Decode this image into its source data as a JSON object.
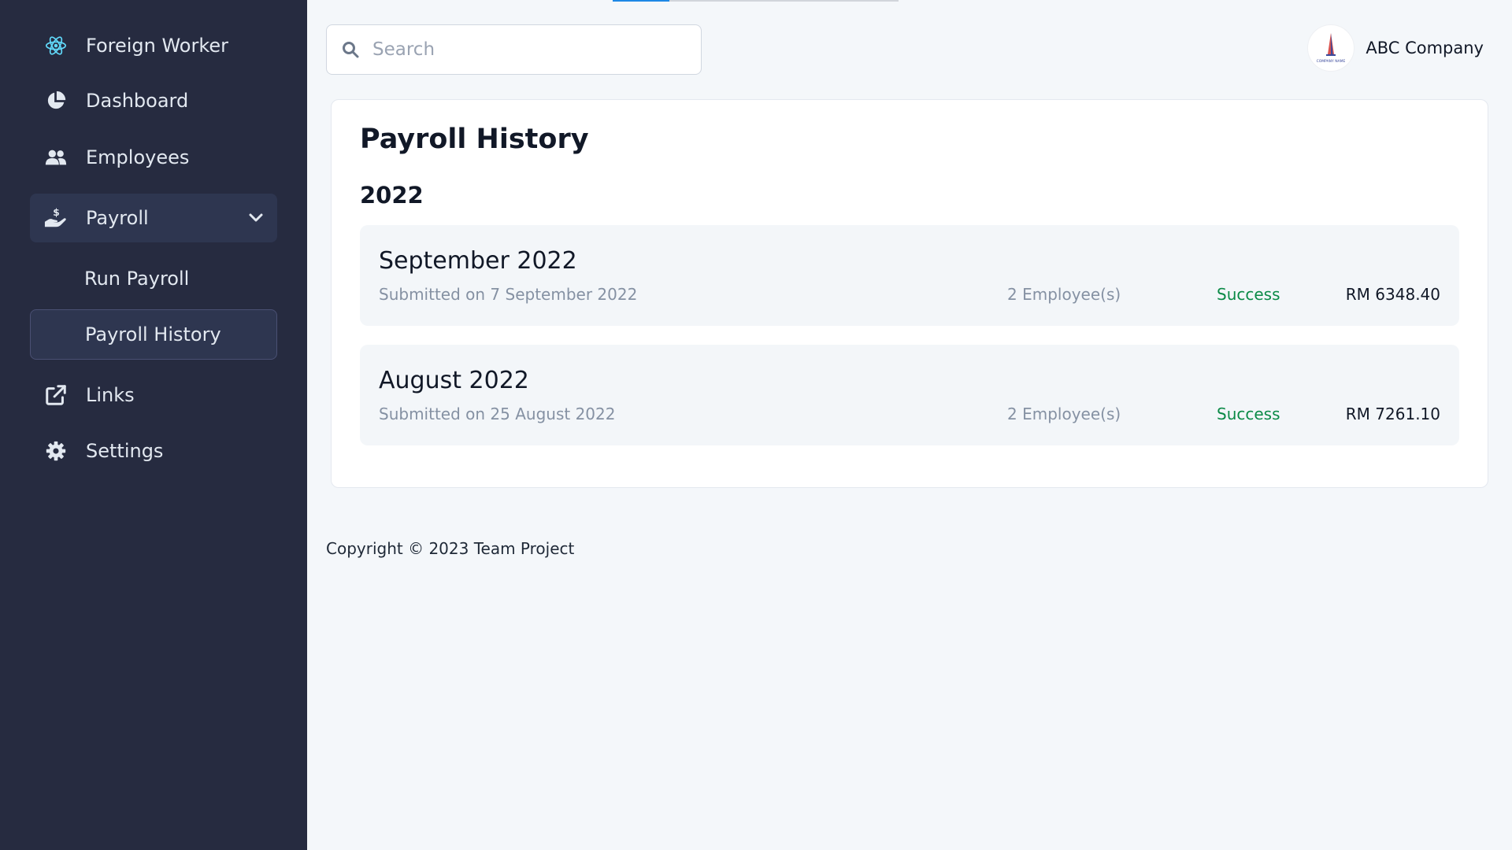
{
  "sidebar": {
    "brand": {
      "label": "Foreign Worker",
      "icon": "react-atom-icon"
    },
    "items": [
      {
        "label": "Dashboard",
        "icon": "pie-chart-icon"
      },
      {
        "label": "Employees",
        "icon": "users-icon"
      },
      {
        "label": "Payroll",
        "icon": "hand-holding-dollar-icon",
        "expanded": true
      },
      {
        "label": "Links",
        "icon": "external-link-icon"
      },
      {
        "label": "Settings",
        "icon": "gear-icon"
      }
    ],
    "payroll_sub": [
      {
        "label": "Run Payroll",
        "active": false
      },
      {
        "label": "Payroll History",
        "active": true
      }
    ]
  },
  "header": {
    "search_placeholder": "Search",
    "search_value": "",
    "company_name": "ABC Company",
    "company_logo_text": "COMPANY NAME"
  },
  "main": {
    "title": "Payroll History",
    "year": "2022",
    "runs": [
      {
        "month": "September 2022",
        "submitted": "Submitted on 7 September 2022",
        "employees": "2 Employee(s)",
        "status": "Success",
        "amount": "RM 6348.40"
      },
      {
        "month": "August 2022",
        "submitted": "Submitted on 25 August 2022",
        "employees": "2 Employee(s)",
        "status": "Success",
        "amount": "RM 7261.10"
      }
    ]
  },
  "footer": {
    "copyright": "Copyright © 2023 Team Project"
  },
  "colors": {
    "sidebar_bg": "#262b40",
    "page_bg": "#f4f7fa",
    "success": "#0b8a47",
    "accent": "#1e88e5"
  }
}
